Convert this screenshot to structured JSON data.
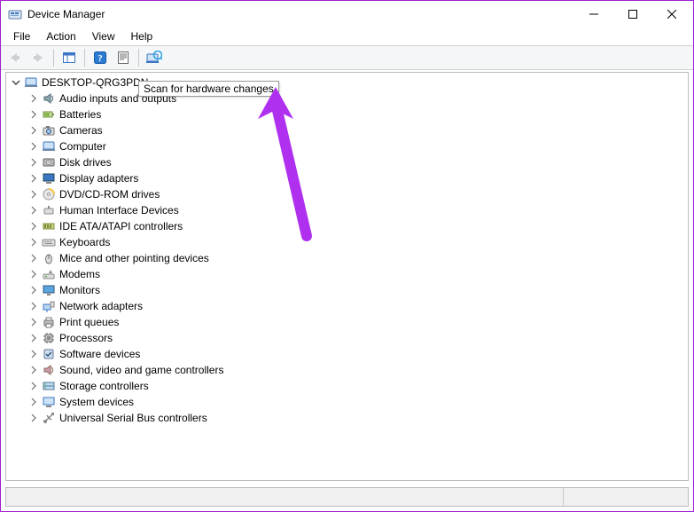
{
  "window": {
    "title": "Device Manager"
  },
  "menu": {
    "file": "File",
    "action": "Action",
    "view": "View",
    "help": "Help"
  },
  "tooltip": {
    "scan": "Scan for hardware changes"
  },
  "tree": {
    "root": "DESKTOP-QRG3PDN",
    "items": [
      "Audio inputs and outputs",
      "Batteries",
      "Cameras",
      "Computer",
      "Disk drives",
      "Display adapters",
      "DVD/CD-ROM drives",
      "Human Interface Devices",
      "IDE ATA/ATAPI controllers",
      "Keyboards",
      "Mice and other pointing devices",
      "Modems",
      "Monitors",
      "Network adapters",
      "Print queues",
      "Processors",
      "Software devices",
      "Sound, video and game controllers",
      "Storage controllers",
      "System devices",
      "Universal Serial Bus controllers"
    ]
  }
}
